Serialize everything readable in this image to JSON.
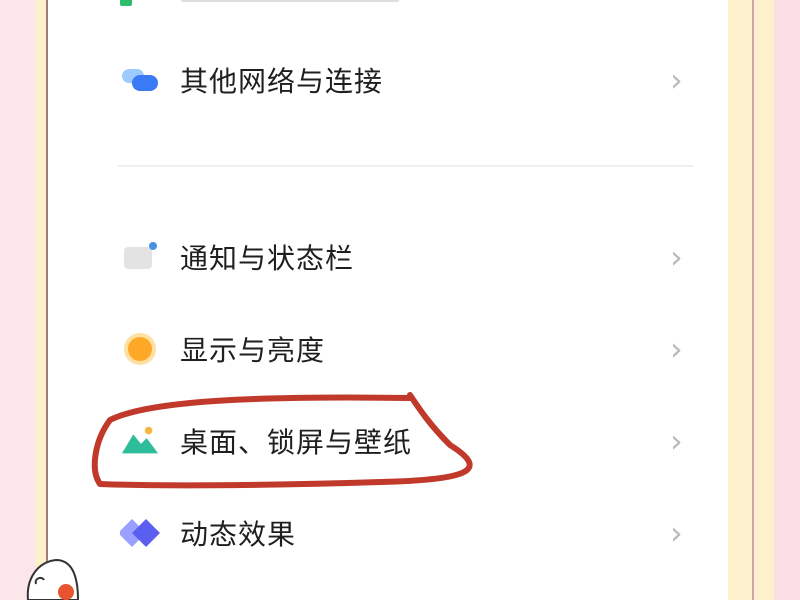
{
  "settings": {
    "items": [
      {
        "label": "其他网络与连接",
        "icon": "network-bubbles-icon"
      },
      {
        "label": "通知与状态栏",
        "icon": "notification-icon"
      },
      {
        "label": "显示与亮度",
        "icon": "brightness-sun-icon"
      },
      {
        "label": "桌面、锁屏与壁纸",
        "icon": "wallpaper-mountain-icon"
      },
      {
        "label": "动态效果",
        "icon": "motion-effects-icon"
      }
    ],
    "chevron": "›"
  },
  "colors": {
    "annotation": "#c0392b",
    "network_icon": "#3a7bf5",
    "sun_icon": "#ffa726",
    "mountain_icon": "#2ebd9b",
    "motion_icon": "#5b5ff0"
  }
}
